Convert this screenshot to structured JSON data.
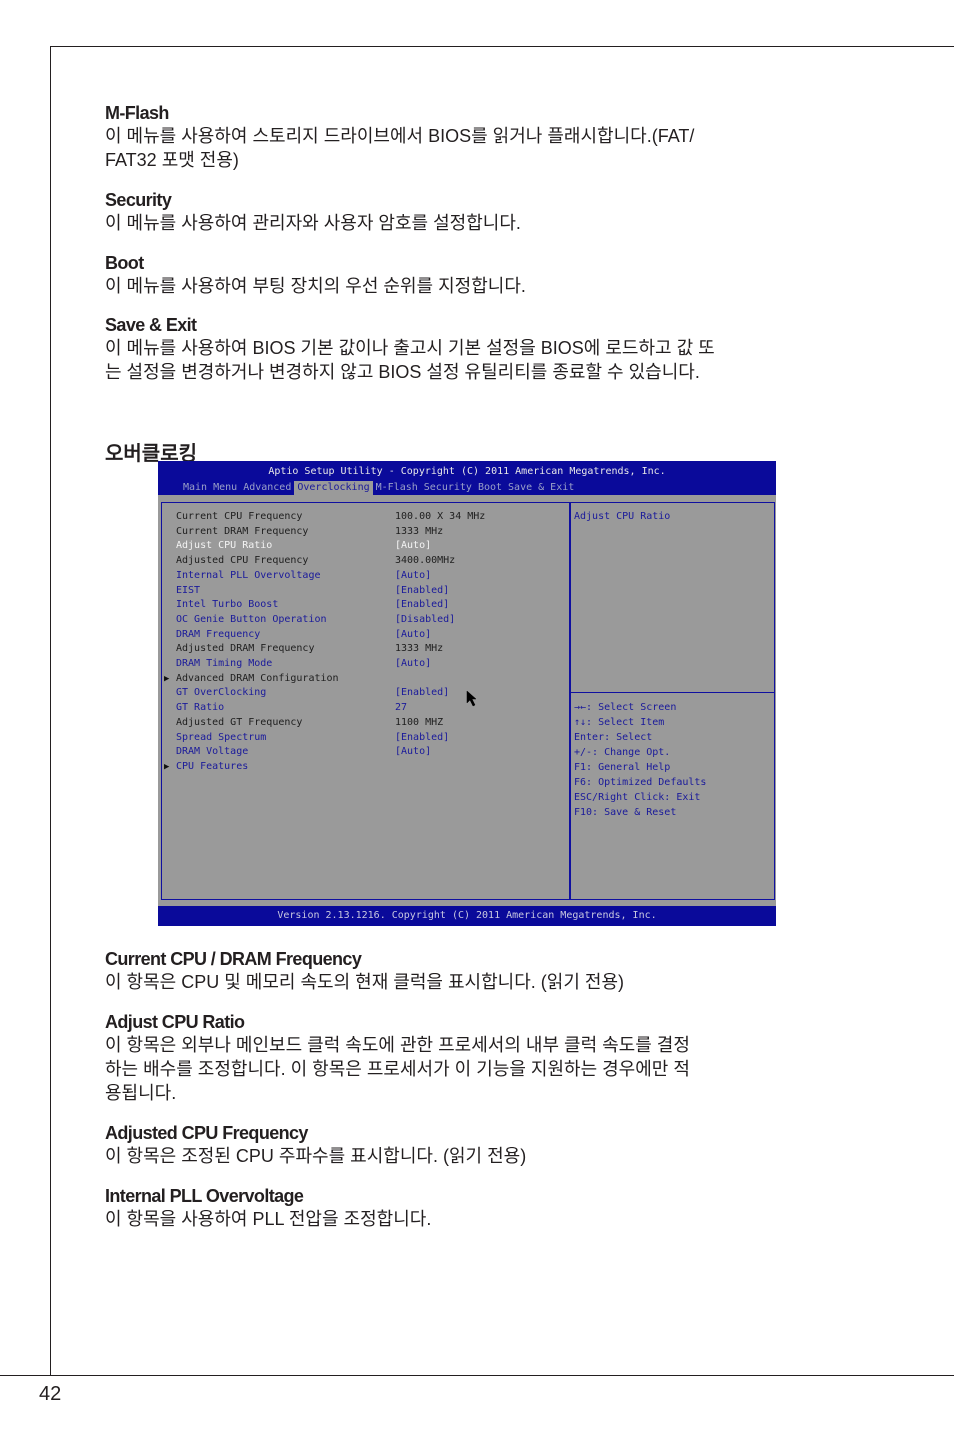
{
  "page_number": "42",
  "sections_top": [
    {
      "title": "M-Flash",
      "body": [
        "이 메뉴를 사용하여 스토리지 드라이브에서 BIOS를 읽거나 플래시합니다.(FAT/",
        "FAT32 포맷 전용)"
      ]
    },
    {
      "title": "Security",
      "body": [
        "이 메뉴를 사용하여 관리자와 사용자 암호를 설정합니다."
      ]
    },
    {
      "title": "Boot",
      "body": [
        "이 메뉴를 사용하여 부팅 장치의 우선 순위를 지정합니다."
      ]
    },
    {
      "title": "Save & Exit",
      "body": [
        "이 메뉴를 사용하여 BIOS 기본 값이나 출고시 기본 설정을 BIOS에 로드하고 값 또",
        "는 설정을 변경하거나 변경하지 않고 BIOS 설정 유틸리티를 종료할 수 있습니다."
      ]
    }
  ],
  "main_heading": "오버클로킹",
  "bios": {
    "title": "Aptio Setup Utility - Copyright (C) 2011 American Megatrends, Inc.",
    "tabs": [
      "Main Menu",
      "Advanced",
      "Overclocking",
      "M-Flash",
      "Security",
      "Boot",
      "Save & Exit"
    ],
    "active_tab": "Overclocking",
    "rows": [
      {
        "label": "Current CPU Frequency",
        "value": "100.00 X 34 MHz",
        "style": "dark"
      },
      {
        "label": "Current DRAM Frequency",
        "value": "1333 MHz",
        "style": "dark"
      },
      {
        "label": "Adjust CPU Ratio",
        "value": "[Auto]",
        "style": "white"
      },
      {
        "label": "Adjusted CPU Frequency",
        "value": "3400.00MHz",
        "style": "dark"
      },
      {
        "label": "Internal PLL Overvoltage",
        "value": "[Auto]",
        "style": "blue"
      },
      {
        "label": "EIST",
        "value": "[Enabled]",
        "style": "blue"
      },
      {
        "label": "Intel Turbo Boost",
        "value": "[Enabled]",
        "style": "blue"
      },
      {
        "label": "OC Genie Button Operation",
        "value": "[Disabled]",
        "style": "blue"
      },
      {
        "label": "DRAM Frequency",
        "value": "[Auto]",
        "style": "blue"
      },
      {
        "label": "Adjusted DRAM Frequency",
        "value": "1333 MHz",
        "style": "dark"
      },
      {
        "label": "DRAM Timing Mode",
        "value": "[Auto]",
        "style": "blue"
      },
      {
        "label": "Advanced DRAM Configuration",
        "value": "",
        "style": "dark",
        "submenu": true
      },
      {
        "label": "GT OverClocking",
        "value": "[Enabled]",
        "style": "blue"
      },
      {
        "label": "GT Ratio",
        "value": "27",
        "style": "blue"
      },
      {
        "label": "Adjusted GT Frequency",
        "value": "1100 MHZ",
        "style": "dark"
      },
      {
        "label": "Spread Spectrum",
        "value": "[Enabled]",
        "style": "blue"
      },
      {
        "label": "DRAM Voltage",
        "value": "[Auto]",
        "style": "blue"
      },
      {
        "label": "CPU Features",
        "value": "",
        "style": "blue",
        "submenu": true
      }
    ],
    "help_title": "Adjust CPU Ratio",
    "help_keys": [
      "→←: Select Screen",
      "↑↓: Select Item",
      "Enter: Select",
      "+/-: Change Opt.",
      "F1: General Help",
      "F6: Optimized Defaults",
      "ESC/Right Click: Exit",
      "F10: Save & Reset"
    ],
    "footer": "Version 2.13.1216. Copyright (C) 2011 American Megatrends, Inc."
  },
  "sections_bottom": [
    {
      "title": "Current CPU / DRAM Frequency",
      "body": [
        "이 항목은 CPU 및 메모리 속도의 현재 클럭을 표시합니다. (읽기 전용)"
      ]
    },
    {
      "title": "Adjust CPU Ratio",
      "body": [
        "이 항목은 외부나 메인보드 클럭 속도에 관한 프로세서의 내부 클럭 속도를 결정",
        "하는 배수를 조정합니다. 이 항목은 프로세서가 이 기능을 지원하는 경우에만 적",
        "용됩니다."
      ]
    },
    {
      "title": "Adjusted CPU Frequency",
      "body": [
        "이 항목은 조정된 CPU 주파수를 표시합니다. (읽기 전용)"
      ]
    },
    {
      "title": "Internal PLL Overvoltage",
      "body": [
        "이 항목을 사용하여 PLL 전압을 조정합니다."
      ]
    }
  ]
}
